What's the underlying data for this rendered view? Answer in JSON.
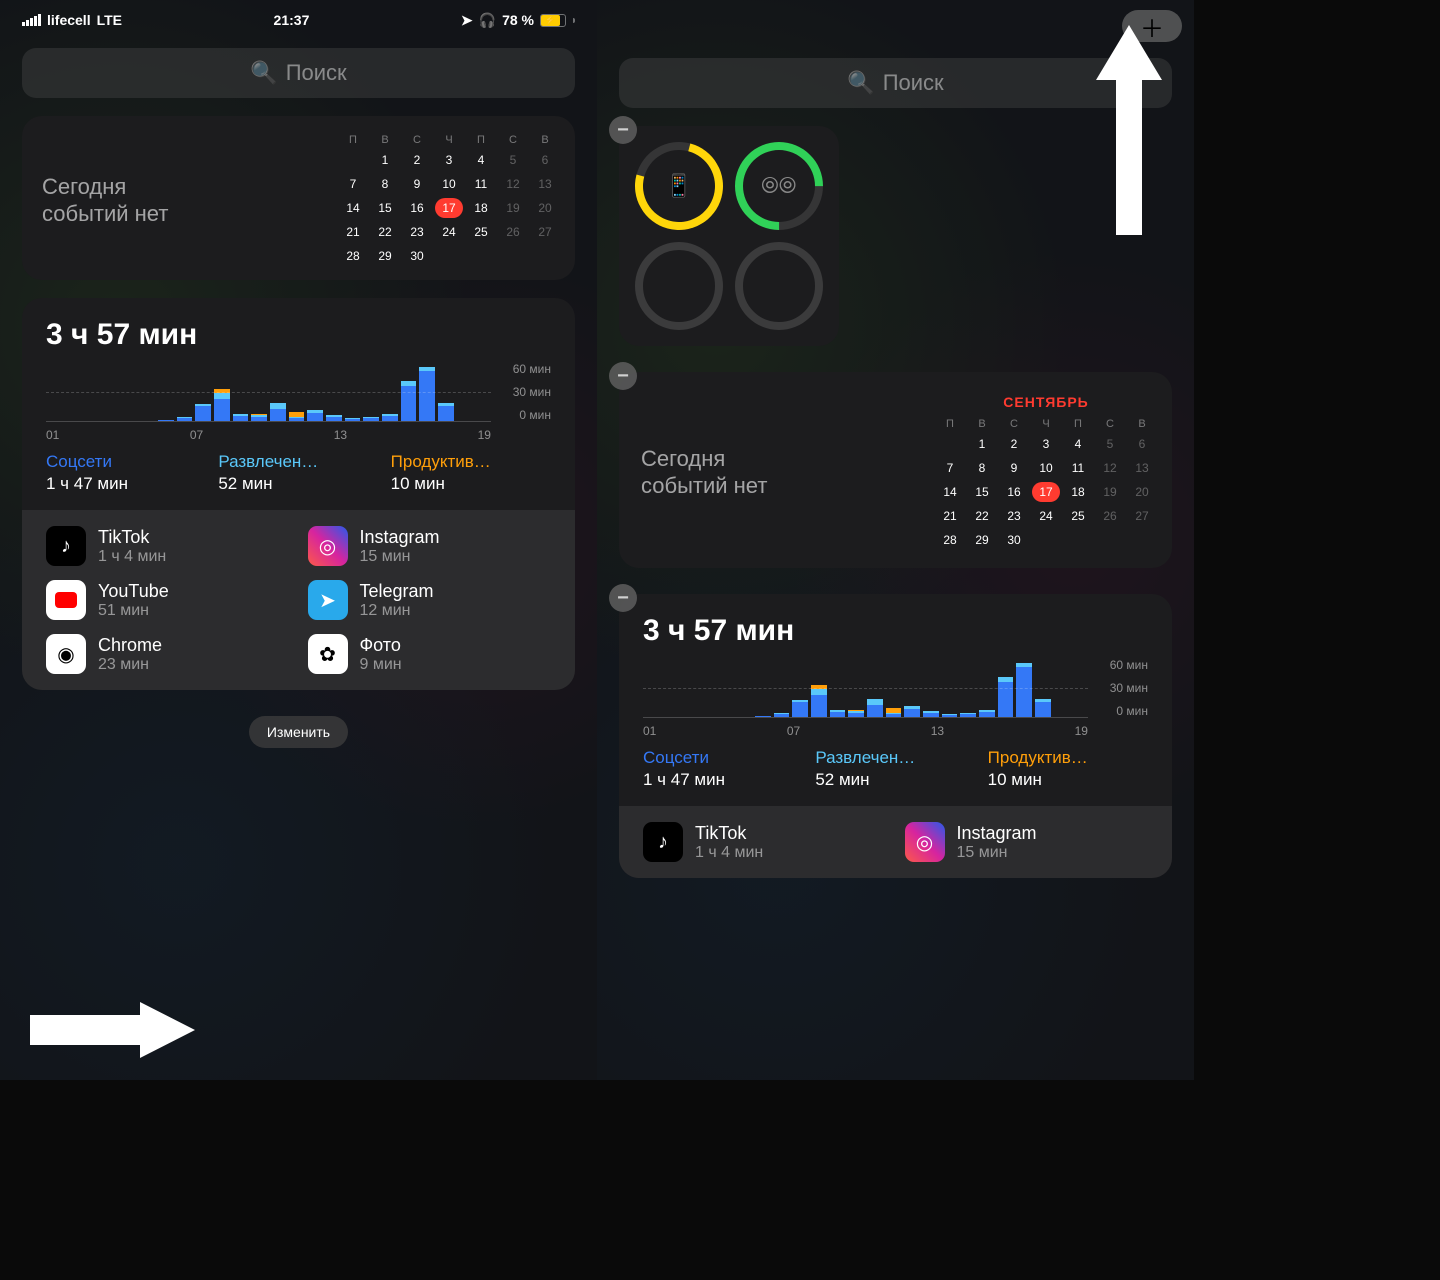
{
  "status": {
    "carrier": "lifecell",
    "network": "LTE",
    "time": "21:37",
    "battery": "78 %"
  },
  "search": {
    "placeholder": "Поиск"
  },
  "calendar": {
    "noEventsLine1": "Сегодня",
    "noEventsLine2": "событий нет",
    "month": "СЕНТЯБРЬ",
    "dow": [
      "П",
      "В",
      "С",
      "Ч",
      "П",
      "С",
      "В"
    ],
    "days": [
      {
        "d": "",
        "dim": true
      },
      {
        "d": "1"
      },
      {
        "d": "2"
      },
      {
        "d": "3"
      },
      {
        "d": "4"
      },
      {
        "d": "5",
        "dim": true
      },
      {
        "d": "6",
        "dim": true
      },
      {
        "d": "7"
      },
      {
        "d": "8"
      },
      {
        "d": "9"
      },
      {
        "d": "10"
      },
      {
        "d": "11"
      },
      {
        "d": "12",
        "dim": true
      },
      {
        "d": "13",
        "dim": true
      },
      {
        "d": "14"
      },
      {
        "d": "15"
      },
      {
        "d": "16"
      },
      {
        "d": "17",
        "today": true
      },
      {
        "d": "18"
      },
      {
        "d": "19",
        "dim": true
      },
      {
        "d": "20",
        "dim": true
      },
      {
        "d": "21"
      },
      {
        "d": "22"
      },
      {
        "d": "23"
      },
      {
        "d": "24"
      },
      {
        "d": "25"
      },
      {
        "d": "26",
        "dim": true
      },
      {
        "d": "27",
        "dim": true
      },
      {
        "d": "28"
      },
      {
        "d": "29"
      },
      {
        "d": "30"
      },
      {
        "d": ""
      },
      {
        "d": ""
      },
      {
        "d": ""
      },
      {
        "d": ""
      }
    ]
  },
  "screenTime": {
    "total": "3 ч 57 мин",
    "yLabels": [
      "60 мин",
      "30 мин",
      "0 мин"
    ],
    "xLabels": [
      "01",
      "07",
      "13",
      "19"
    ],
    "categories": [
      {
        "name": "Соцсети",
        "time": "1 ч 47 мин",
        "class": "c-blue"
      },
      {
        "name": "Развлечен…",
        "time": "52 мин",
        "class": "c-teal"
      },
      {
        "name": "Продуктив…",
        "time": "10 мин",
        "class": "c-orange"
      }
    ],
    "apps": [
      {
        "name": "TikTok",
        "time": "1 ч 4 мин",
        "ic": "ic-tiktok",
        "glyph": "♪"
      },
      {
        "name": "Instagram",
        "time": "15 мин",
        "ic": "ic-instagram",
        "glyph": "◎"
      },
      {
        "name": "YouTube",
        "time": "51 мин",
        "ic": "ic-youtube",
        "glyph": ""
      },
      {
        "name": "Telegram",
        "time": "12 мин",
        "ic": "ic-telegram",
        "glyph": "➤"
      },
      {
        "name": "Chrome",
        "time": "23 мин",
        "ic": "ic-chrome",
        "glyph": "◉"
      },
      {
        "name": "Фото",
        "time": "9 мин",
        "ic": "ic-photos",
        "glyph": "✿"
      }
    ]
  },
  "edit": {
    "label": "Изменить"
  },
  "chart_data": {
    "type": "bar",
    "title": "3 ч 57 мин",
    "ylabel": "мин",
    "ylim": [
      0,
      60
    ],
    "x": [
      1,
      2,
      3,
      4,
      5,
      6,
      7,
      8,
      9,
      10,
      11,
      12,
      13,
      14,
      15,
      16,
      17,
      18,
      19,
      20,
      21,
      22,
      23,
      24
    ],
    "series": [
      {
        "name": "Соцсети",
        "values": [
          0,
          0,
          0,
          0,
          0,
          0,
          1,
          3,
          15,
          22,
          5,
          4,
          12,
          3,
          8,
          4,
          2,
          3,
          5,
          35,
          50,
          15,
          0,
          0
        ]
      },
      {
        "name": "Развлечен",
        "values": [
          0,
          0,
          0,
          0,
          0,
          0,
          0,
          1,
          2,
          6,
          2,
          2,
          6,
          1,
          3,
          2,
          1,
          1,
          2,
          5,
          4,
          3,
          0,
          0
        ]
      },
      {
        "name": "Продуктив",
        "values": [
          0,
          0,
          0,
          0,
          0,
          0,
          0,
          0,
          0,
          4,
          0,
          1,
          0,
          5,
          0,
          0,
          0,
          0,
          0,
          0,
          0,
          0,
          0,
          0
        ]
      }
    ]
  }
}
